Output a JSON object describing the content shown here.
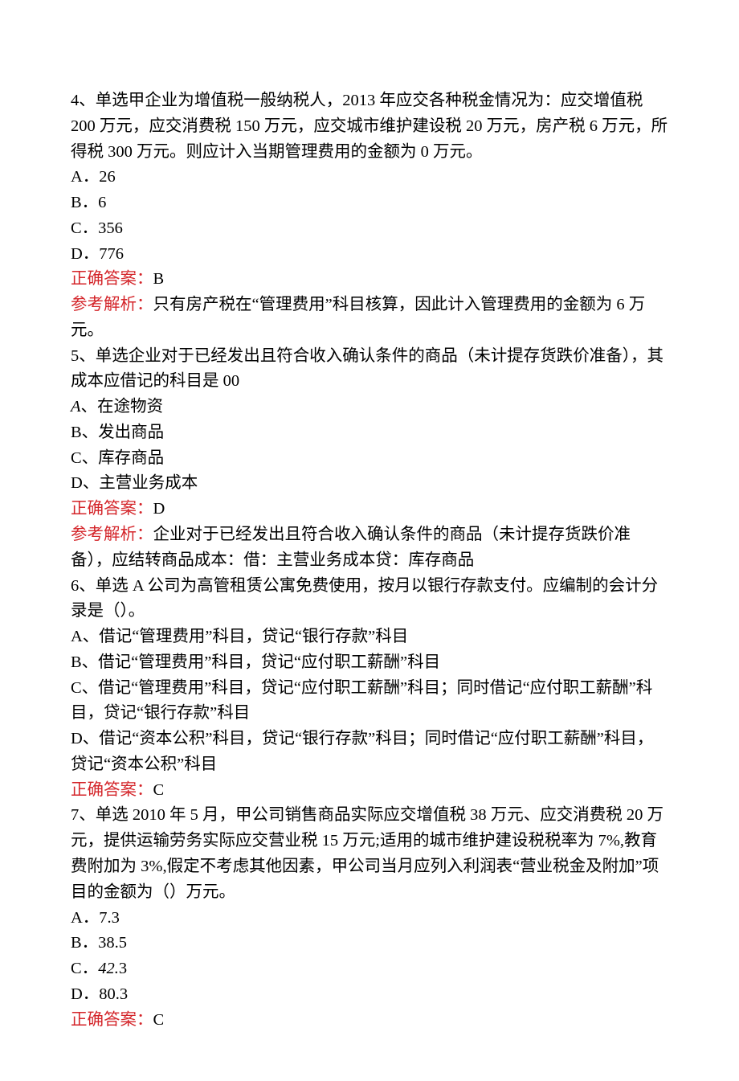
{
  "q4": {
    "stem": "4、单选甲企业为增值税一般纳税人，2013 年应交各种税金情况为：应交增值税 200 万元，应交消费税 150 万元，应交城市维护建设税 20 万元，房产税 6 万元，所得税 300 万元。则应计入当期管理费用的金额为 0 万元。",
    "options": {
      "a": "A．26",
      "b": "B．6",
      "c": "C．356",
      "d": "D．776"
    },
    "answer_label": "正确答案：",
    "answer_value": "B",
    "explain_label": "参考解析：",
    "explain_text": "只有房产税在“管理费用”科目核算，因此计入管理费用的金额为 6 万元。"
  },
  "q5": {
    "stem": "5、单选企业对于已经发出且符合收入确认条件的商品（未计提存货跌价准备），其成本应借记的科目是 00",
    "options": {
      "a_label": "A",
      "a_sep": "、在途物资",
      "b": "B、发出商品",
      "c": "C、库存商品",
      "d": "D、主营业务成本"
    },
    "answer_label": "正确答案：",
    "answer_value": "D",
    "explain_label": "参考解析：",
    "explain_text": "企业对于已经发出且符合收入确认条件的商品（未计提存货跌价准备），应结转商品成本：借：主营业务成本贷：库存商品"
  },
  "q6": {
    "stem": "6、单选 A 公司为高管租赁公寓免费使用，按月以银行存款支付。应编制的会计分录是（）。",
    "options": {
      "a": "A、借记“管理费用”科目，贷记“银行存款”科目",
      "b": "B、借记“管理费用”科目，贷记“应付职工薪酬”科目",
      "c": "C、借记“管理费用”科目，贷记“应付职工薪酬”科目；同时借记“应付职工薪酬”科目，贷记“银行存款”科目",
      "d": "D、借记“资本公积”科目，贷记“银行存款”科目；同时借记“应付职工薪酬”科目，贷记“资本公积”科目"
    },
    "answer_label": "正确答案：",
    "answer_value": "C"
  },
  "q7": {
    "stem": "7、单选 2010 年 5 月，甲公司销售商品实际应交增值税 38 万元、应交消费税 20 万元，提供运输劳务实际应交营业税 15 万元;适用的城市维护建设税税率为 7%,教育费附加为 3%,假定不考虑其他因素，甲公司当月应列入利润表“营业税金及附加”项目的金额为（）万元。",
    "options": {
      "a": "A．7.3",
      "b": "B．38.5",
      "c_prefix": "C．",
      "c_italic": "42.",
      "c_suffix": "3",
      "d": "D．80.3"
    },
    "answer_label": "正确答案：",
    "answer_value": "C"
  }
}
